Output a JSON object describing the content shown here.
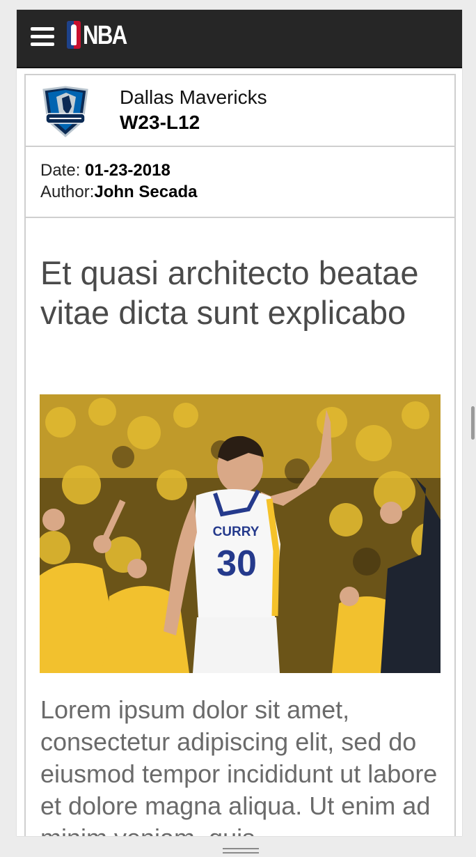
{
  "header": {
    "menu_icon": "hamburger-menu-icon",
    "logo_text": "NBA"
  },
  "team": {
    "logo_icon": "dallas-mavericks-logo",
    "name": "Dallas Mavericks",
    "record": "W23-L12"
  },
  "meta": {
    "date_label": "Date: ",
    "date_value": "01-23-2018",
    "author_label": "Author:",
    "author_value": "John Secada"
  },
  "article": {
    "headline": "Et quasi architecto beatae vitae dicta sunt explicabo",
    "photo_jersey_name": "CURRY",
    "photo_jersey_number": "30",
    "body": "Lorem ipsum dolor sit amet, consectetur adipiscing elit, sed do eiusmod tempor incididunt ut labore et dolore magna aliqua. Ut enim ad minim veniam, quis"
  },
  "colors": {
    "header_bg": "#262626",
    "nba_red": "#c8102e",
    "nba_blue": "#1d428a",
    "border": "#cfcfcf",
    "headline_text": "#4a4a4a",
    "body_text": "#6a6a6a"
  }
}
